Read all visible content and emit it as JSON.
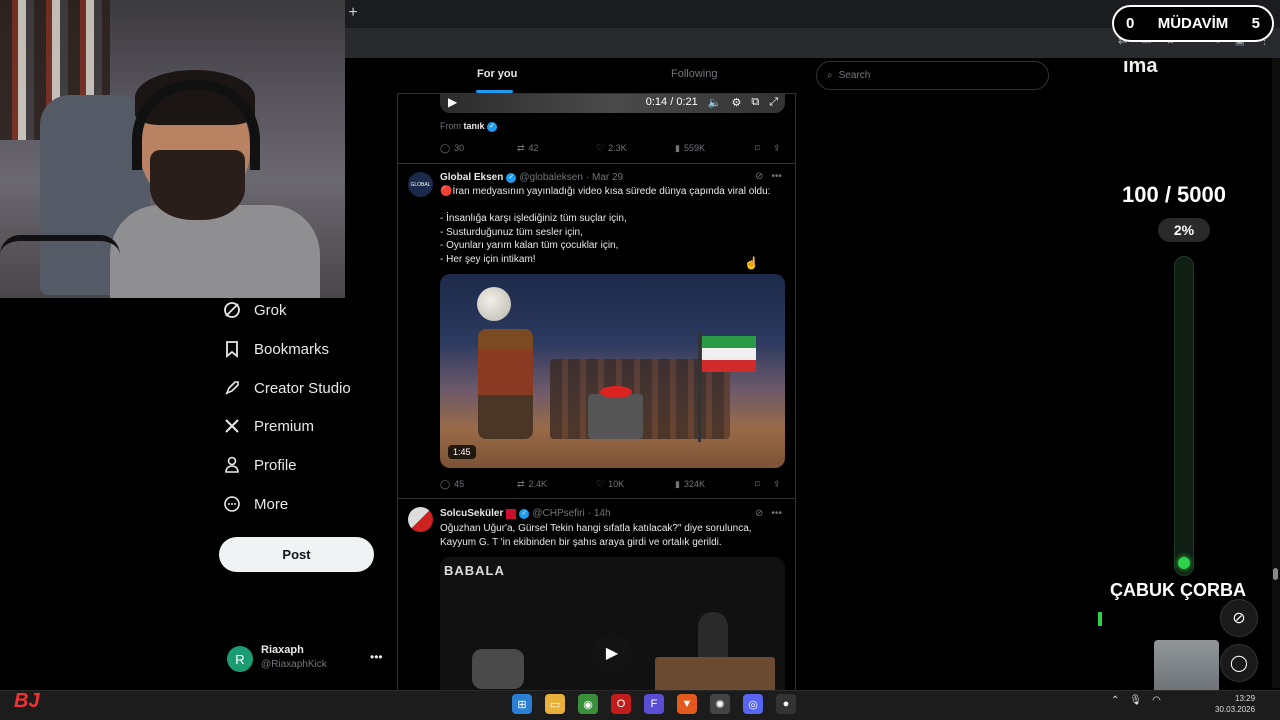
{
  "browser": {
    "new_tab": "+"
  },
  "nav": {
    "items": [
      {
        "label": "Grok",
        "icon": "grok-icon"
      },
      {
        "label": "Bookmarks",
        "icon": "bookmark-icon"
      },
      {
        "label": "Creator Studio",
        "icon": "rocket-icon"
      },
      {
        "label": "Premium",
        "icon": "x-logo-icon"
      },
      {
        "label": "Profile",
        "icon": "person-icon"
      },
      {
        "label": "More",
        "icon": "more-circle-icon"
      }
    ],
    "post_label": "Post",
    "account": {
      "initial": "R",
      "name": "Riaxaph",
      "handle": "@RiaxaphKick",
      "more": "•••"
    }
  },
  "feed": {
    "tabs": [
      "For you",
      "Following"
    ],
    "video1": {
      "time": "0:14 / 0:21",
      "from_label": "From",
      "from_name": "tanık"
    },
    "actions1": {
      "replies": "30",
      "reposts": "42",
      "likes": "2.3K",
      "views": "559K"
    },
    "tweet2": {
      "name": "Global Eksen",
      "handle": "@globaleksen",
      "date": "· Mar 29",
      "avatar_text": "GLOBAL",
      "text": "🔴İran medyasının yayınladığı video kısa sürede dünya çapında viral oldu:\n\n- İnsanlığa karşı işlediğiniz tüm suçlar için,\n- Susturduğunuz tüm sesler için,\n- Oyunları yarım kalan tüm çocuklar için,\n- Her şey için intikam!",
      "duration": "1:45",
      "replies": "45",
      "reposts": "2.4K",
      "likes": "10K",
      "views": "324K"
    },
    "tweet3": {
      "name": "SolcuSeküler",
      "handle": "@CHPsefiri",
      "date": "· 14h",
      "text": "Oğuzhan Uğur'a, Gürsel Tekin hangi sıfatla katılacak?\" diye sorulunca,\nKayyum G. T 'in ekibinden bir şahıs araya girdi ve ortalık gerildi.",
      "media_logo": "BABALA"
    }
  },
  "search": {
    "placeholder": "Search"
  },
  "overlay": {
    "left_count": "0",
    "label": "MÜDAVİM",
    "right_count": "5",
    "scroll_text": "ıma",
    "goal": "100 / 5000",
    "percent": "2%",
    "progress": 0.02,
    "bottom_text": "ÇABUK ÇORBA",
    "accent": "#2fd14a"
  },
  "taskbar": {
    "time": "13:29",
    "date": "30.03.2026"
  }
}
